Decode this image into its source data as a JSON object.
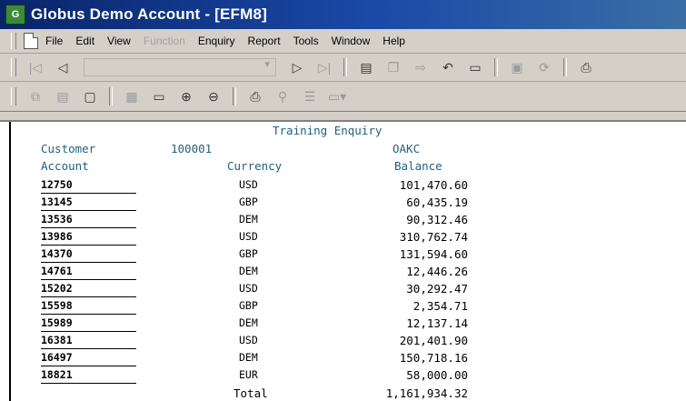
{
  "window": {
    "title": "Globus Demo Account - [EFM8]"
  },
  "menu": {
    "items": [
      "File",
      "Edit",
      "View",
      "Function",
      "Enquiry",
      "Report",
      "Tools",
      "Window",
      "Help"
    ],
    "disabled": [
      "Function"
    ]
  },
  "toolbar1": {
    "buttons": [
      "first-record-icon",
      "previous-record-icon",
      "record-combo",
      "next-record-icon",
      "last-record-icon",
      "save-icon",
      "copy-icon",
      "export-icon",
      "undo-icon",
      "open-icon",
      "view-icon",
      "refresh-icon",
      "print-icon"
    ]
  },
  "toolbar2": {
    "buttons": [
      "copy-rows-icon",
      "paste-icon",
      "new-icon",
      "grid-icon",
      "folder-icon",
      "zoom-in-icon",
      "zoom-out-icon",
      "print-icon",
      "find-icon",
      "columns-icon",
      "layout-icon"
    ]
  },
  "report": {
    "title": "Training Enquiry",
    "customer_label": "Customer",
    "customer_id": "100001",
    "customer_name": "OAKC",
    "col_account": "Account",
    "col_currency": "Currency",
    "col_balance": "Balance",
    "rows": [
      {
        "account": "12750",
        "currency": "USD",
        "balance": "101,470.60"
      },
      {
        "account": "13145",
        "currency": "GBP",
        "balance": "60,435.19"
      },
      {
        "account": "13536",
        "currency": "DEM",
        "balance": "90,312.46"
      },
      {
        "account": "13986",
        "currency": "USD",
        "balance": "310,762.74"
      },
      {
        "account": "14370",
        "currency": "GBP",
        "balance": "131,594.60"
      },
      {
        "account": "14761",
        "currency": "DEM",
        "balance": "12,446.26"
      },
      {
        "account": "15202",
        "currency": "USD",
        "balance": "30,292.47"
      },
      {
        "account": "15598",
        "currency": "GBP",
        "balance": "2,354.71"
      },
      {
        "account": "15989",
        "currency": "DEM",
        "balance": "12,137.14"
      },
      {
        "account": "16381",
        "currency": "USD",
        "balance": "201,401.90"
      },
      {
        "account": "16497",
        "currency": "DEM",
        "balance": "150,718.16"
      },
      {
        "account": "18821",
        "currency": "EUR",
        "balance": "58,000.00"
      }
    ],
    "total_label": "Total",
    "total_value": "1,161,934.32"
  }
}
